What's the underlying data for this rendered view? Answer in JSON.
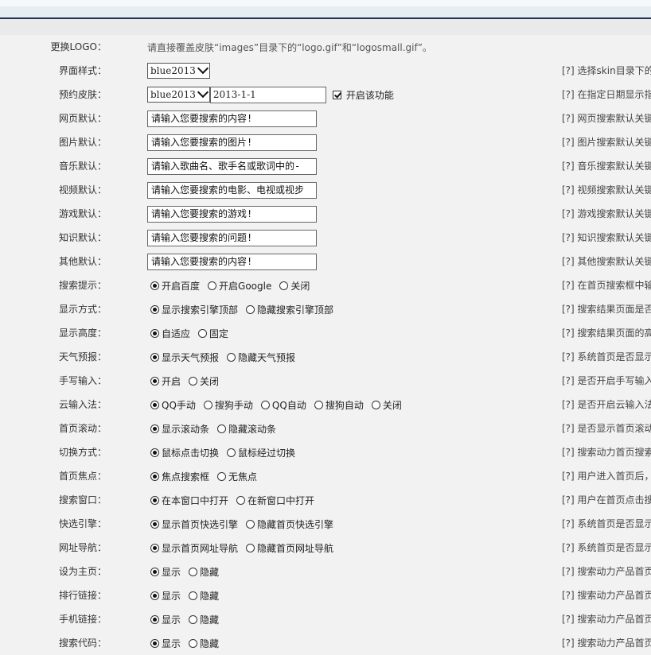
{
  "logo_row": {
    "label": "更换LOGO：",
    "note": "请直接覆盖皮肤“images”目录下的“logo.gif”和“logosmall.gif”。"
  },
  "rows": [
    {
      "id": "skin",
      "label": "界面样式：",
      "type": "select",
      "value": "blue2013",
      "hint": "[?] 选择skin目录下的"
    },
    {
      "id": "schedule",
      "label": "预约皮肤：",
      "type": "select_date",
      "value": "blue2013",
      "date": "2013-1-1",
      "checkbox_label": "开启该功能",
      "checked": true,
      "hint": "[?] 在指定日期显示指"
    },
    {
      "id": "web",
      "label": "网页默认：",
      "type": "text",
      "value": "请输入您要搜索的内容!",
      "hint": "[?] 网页搜索默认关键"
    },
    {
      "id": "image",
      "label": "图片默认：",
      "type": "text",
      "value": "请输入您要搜索的图片!",
      "hint": "[?] 图片搜索默认关键"
    },
    {
      "id": "music",
      "label": "音乐默认：",
      "type": "text",
      "value": "请输入歌曲名、歌手名或歌词中的-",
      "hint": "[?] 音乐搜索默认关键"
    },
    {
      "id": "video",
      "label": "视频默认：",
      "type": "text",
      "value": "请输入您要搜索的电影、电视或视步",
      "hint": "[?] 视频搜索默认关键"
    },
    {
      "id": "game",
      "label": "游戏默认：",
      "type": "text",
      "value": "请输入您要搜索的游戏!",
      "hint": "[?] 游戏搜索默认关键"
    },
    {
      "id": "knowledge",
      "label": "知识默认：",
      "type": "text",
      "value": "请输入您要搜索的问题!",
      "hint": "[?] 知识搜索默认关键"
    },
    {
      "id": "other",
      "label": "其他默认：",
      "type": "text",
      "value": "请输入您要搜索的内容!",
      "hint": "[?] 其他搜索默认关键"
    },
    {
      "id": "suggest",
      "label": "搜索提示：",
      "type": "radio",
      "options": [
        "开启百度",
        "开启Google",
        "关闭"
      ],
      "selected": 0,
      "hint": "[?] 在首页搜索框中输"
    },
    {
      "id": "display",
      "label": "显示方式：",
      "type": "radio",
      "options": [
        "显示搜索引擎顶部",
        "隐藏搜索引擎顶部"
      ],
      "selected": 0,
      "hint": "[?] 搜索结果页面是否"
    },
    {
      "id": "height",
      "label": "显示高度：",
      "type": "radio",
      "options": [
        "自适应",
        "固定"
      ],
      "selected": 0,
      "hint": "[?] 搜索结果页面的高"
    },
    {
      "id": "weather",
      "label": "天气预报：",
      "type": "radio",
      "options": [
        "显示天气预报",
        "隐藏天气预报"
      ],
      "selected": 0,
      "hint": "[?] 系统首页是否显示"
    },
    {
      "id": "handwrite",
      "label": "手写输入：",
      "type": "radio",
      "options": [
        "开启",
        "关闭"
      ],
      "selected": 0,
      "hint": "[?] 是否开启手写输入"
    },
    {
      "id": "cloudime",
      "label": "云输入法：",
      "type": "radio",
      "options": [
        "QQ手动",
        "搜狗手动",
        "QQ自动",
        "搜狗自动",
        "关闭"
      ],
      "selected": 0,
      "hint": "[?] 是否开启云输入法"
    },
    {
      "id": "scroll",
      "label": "首页滚动：",
      "type": "radio",
      "options": [
        "显示滚动条",
        "隐藏滚动条"
      ],
      "selected": 0,
      "hint": "[?] 是否显示首页滚动"
    },
    {
      "id": "switch",
      "label": "切换方式：",
      "type": "radio",
      "options": [
        "鼠标点击切换",
        "鼠标经过切换"
      ],
      "selected": 0,
      "hint": "[?] 搜索动力首页搜索"
    },
    {
      "id": "focus",
      "label": "首页焦点：",
      "type": "radio",
      "options": [
        "焦点搜索框",
        "无焦点"
      ],
      "selected": 0,
      "hint": "[?] 用户进入首页后，"
    },
    {
      "id": "window",
      "label": "搜索窗口：",
      "type": "radio",
      "options": [
        "在本窗口中打开",
        "在新窗口中打开"
      ],
      "selected": 0,
      "hint": "[?] 用户在首页点击搜"
    },
    {
      "id": "quickengine",
      "label": "快选引擎：",
      "type": "radio",
      "options": [
        "显示首页快选引擎",
        "隐藏首页快选引擎"
      ],
      "selected": 0,
      "hint": "[?] 系统首页是否显示"
    },
    {
      "id": "urlnav",
      "label": "网址导航：",
      "type": "radio",
      "options": [
        "显示首页网址导航",
        "隐藏首页网址导航"
      ],
      "selected": 0,
      "hint": "[?] 系统首页是否显示"
    },
    {
      "id": "homepage",
      "label": "设为主页：",
      "type": "radio",
      "options": [
        "显示",
        "隐藏"
      ],
      "selected": 0,
      "hint": "[?] 搜索动力产品首页"
    },
    {
      "id": "ranking",
      "label": "排行链接：",
      "type": "radio",
      "options": [
        "显示",
        "隐藏"
      ],
      "selected": 0,
      "hint": "[?] 搜索动力产品首页"
    },
    {
      "id": "mobile",
      "label": "手机链接：",
      "type": "radio",
      "options": [
        "显示",
        "隐藏"
      ],
      "selected": 0,
      "hint": "[?] 搜索动力产品首页"
    },
    {
      "id": "searchcode",
      "label": "搜索代码：",
      "type": "radio",
      "options": [
        "显示",
        "隐藏"
      ],
      "selected": 0,
      "hint": "[?] 搜索动力产品首页"
    }
  ]
}
